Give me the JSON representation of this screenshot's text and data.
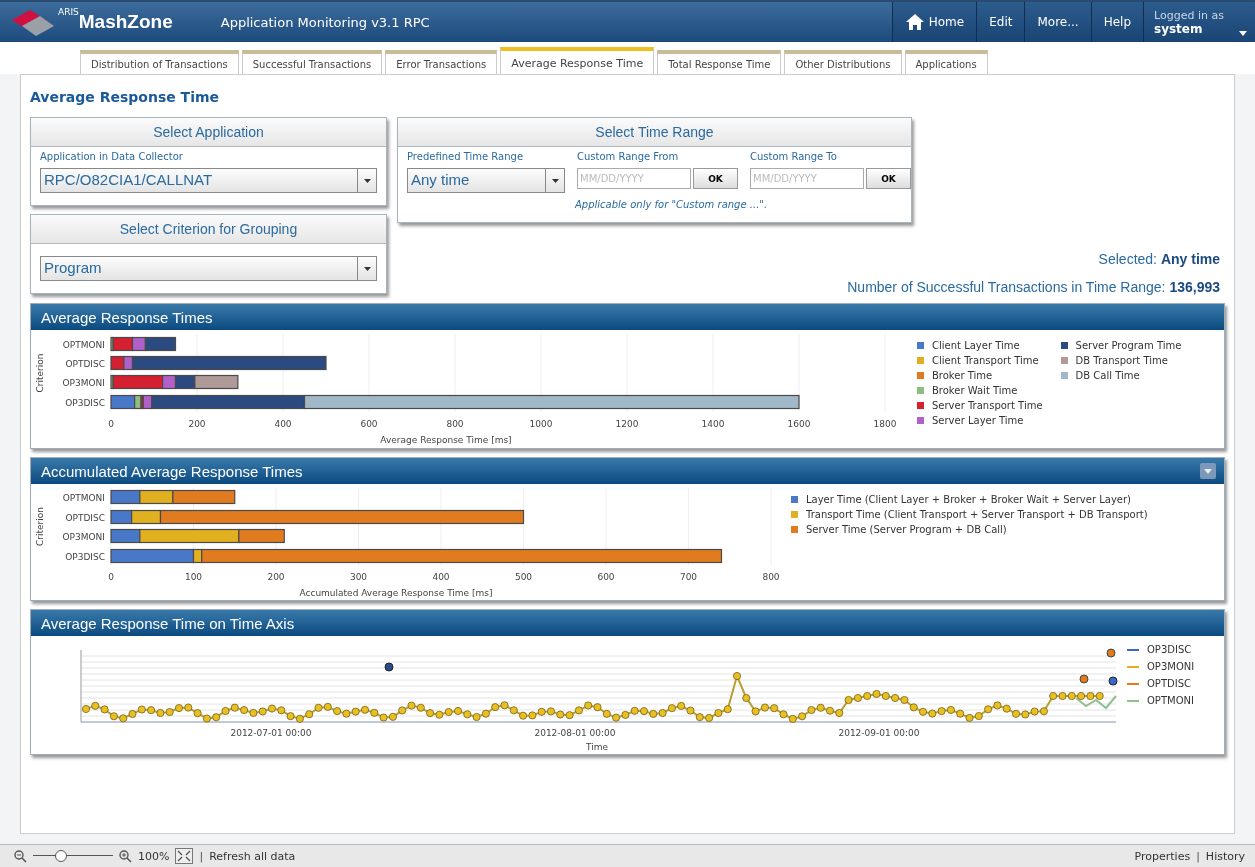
{
  "header": {
    "logo_super": "ARIS",
    "logo": "MashZone",
    "title": "Application Monitoring v3.1 RPC",
    "nav": [
      {
        "label": "Home",
        "kind": "home"
      },
      {
        "label": "Edit",
        "kind": "plain"
      },
      {
        "label": "More...",
        "kind": "plain"
      },
      {
        "label": "Help",
        "kind": "plain"
      }
    ],
    "user": {
      "caption": "Logged in as",
      "name": "system"
    }
  },
  "tabs": [
    {
      "label": "Distribution of Transactions",
      "selected": false
    },
    {
      "label": "Successful Transactions",
      "selected": false
    },
    {
      "label": "Error Transactions",
      "selected": false
    },
    {
      "label": "Average Response Time",
      "selected": true
    },
    {
      "label": "Total Response Time",
      "selected": false
    },
    {
      "label": "Other Distributions",
      "selected": false
    },
    {
      "label": "Applications",
      "selected": false
    }
  ],
  "page_title": "Average Response Time",
  "select_application": {
    "title": "Select Application",
    "label": "Application in Data Collector",
    "value": "RPC/O82CIA1/CALLNAT"
  },
  "select_time_range": {
    "title": "Select Time Range",
    "predefined": {
      "label": "Predefined Time Range",
      "value": "Any time"
    },
    "ranges": [
      {
        "label": "Custom Range From",
        "placeholder": "MM/DD/YYYY",
        "button": "OK"
      },
      {
        "label": "Custom Range To",
        "placeholder": "MM/DD/YYYY",
        "button": "OK"
      }
    ],
    "note": "Applicable only for \"Custom range ...\"."
  },
  "select_grouping": {
    "title": "Select Criterion for Grouping",
    "value": "Program"
  },
  "summary": {
    "selected_label": "Selected:",
    "selected_value": "Any time",
    "count_label": "Number of Successful Transactions in Time Range:",
    "count_value": "136,993"
  },
  "panels": [
    {
      "title": "Average Response Times",
      "collapse_button": false,
      "chart_data": {
        "type": "bar",
        "orientation": "horizontal",
        "stacked": true,
        "grid": true,
        "xlabel": "Average Response Time [ms]",
        "ylabel": "Criterion",
        "categories": [
          "OPTMONI",
          "OPTDISC",
          "OP3MONI",
          "OP3DISC"
        ],
        "xlim": [
          0,
          1800
        ],
        "xticks": [
          0,
          200,
          400,
          600,
          800,
          1000,
          1200,
          1400,
          1600,
          1800
        ],
        "series": [
          {
            "name": "Client Layer Time",
            "color": "#4a78c8",
            "values": [
              0,
              0,
              0,
              55
            ]
          },
          {
            "name": "Client Transport Time",
            "color": "#e0b020",
            "values": [
              0,
              0,
              0,
              0
            ]
          },
          {
            "name": "Broker Time",
            "color": "#e07b20",
            "values": [
              0,
              0,
              0,
              0
            ]
          },
          {
            "name": "Broker Wait Time",
            "color": "#8fbc80",
            "values": [
              5,
              0,
              5,
              15
            ]
          },
          {
            "name": "Server Transport Time",
            "color": "#d42030",
            "values": [
              45,
              30,
              115,
              5
            ]
          },
          {
            "name": "Server Layer Time",
            "color": "#b060c8",
            "values": [
              30,
              20,
              30,
              20
            ]
          },
          {
            "name": "Server Program Time",
            "color": "#2a4a80",
            "values": [
              70,
              450,
              45,
              355
            ]
          },
          {
            "name": "DB Transport Time",
            "color": "#b09a98",
            "values": [
              0,
              0,
              100,
              0
            ]
          },
          {
            "name": "DB Call Time",
            "color": "#a0b8c8",
            "values": [
              0,
              0,
              0,
              1150
            ]
          }
        ]
      }
    },
    {
      "title": "Accumulated Average Response Times",
      "collapse_button": true,
      "chart_data": {
        "type": "bar",
        "orientation": "horizontal",
        "stacked": true,
        "grid": true,
        "xlabel": "Accumulated Average Response Time [ms]",
        "ylabel": "Criterion",
        "categories": [
          "OPTMONI",
          "OPTDISC",
          "OP3MONI",
          "OP3DISC"
        ],
        "xlim": [
          0,
          800
        ],
        "xticks": [
          0,
          100,
          200,
          300,
          400,
          500,
          600,
          700,
          800
        ],
        "series": [
          {
            "name": "Layer Time (Client Layer + Broker + Broker Wait + Server Layer)",
            "color": "#4a78c8",
            "values": [
              35,
              25,
              35,
              100
            ]
          },
          {
            "name": "Transport Time (Client Transport + Server Transport + DB Transport)",
            "color": "#e0b020",
            "values": [
              40,
              35,
              120,
              10
            ]
          },
          {
            "name": "Server Time (Server Program + DB Call)",
            "color": "#e07b20",
            "values": [
              75,
              440,
              55,
              630
            ]
          }
        ]
      }
    }
  ],
  "time_panel": {
    "title": "Average Response Time on Time Axis",
    "x_labels": [
      "2012-07-01 00:00",
      "2012-08-01 00:00",
      "2012-09-01 00:00"
    ],
    "x_title": "Time",
    "legend": [
      {
        "label": "OP3DISC",
        "color": "#3a6ac8"
      },
      {
        "label": "OP3MONI",
        "color": "#e0b020"
      },
      {
        "label": "OPTDISC",
        "color": "#e07b20"
      },
      {
        "label": "OPTMONI",
        "color": "#90c090"
      }
    ]
  },
  "status_bar": {
    "separator": "|",
    "zoom": {
      "level": 0.35
    },
    "zoom_value": "100%",
    "refresh": "Refresh all data",
    "links": [
      "Properties",
      "History"
    ]
  }
}
